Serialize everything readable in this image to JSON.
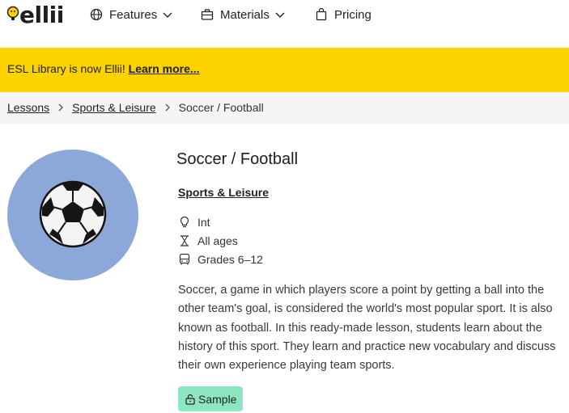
{
  "nav": {
    "logo": "ellii",
    "items": [
      {
        "label": "Features",
        "icon": "globe-icon"
      },
      {
        "label": "Materials",
        "icon": "briefcase-icon"
      },
      {
        "label": "Pricing",
        "icon": "shopping-bag-icon"
      }
    ]
  },
  "banner": {
    "text": "ESL Library is now Ellii! ",
    "link": "Learn more..."
  },
  "breadcrumb": {
    "items": [
      "Lessons",
      "Sports & Leisure",
      "Soccer / Football"
    ]
  },
  "lesson": {
    "title": "Soccer / Football",
    "category": "Sports & Leisure",
    "level": "Int",
    "ages": "All ages",
    "grades": "Grades 6–12",
    "description": "Soccer, a game in which players score a point by getting a ball into the other team's goal, is considered the world's most popular sport. It is also known as football. In this ready-made lesson, students learn about the history of this sport. They learn and practice new vocabulary and discuss their own experience playing team sports.",
    "sample_label": "Sample"
  },
  "colors": {
    "banner": "#fcd200",
    "circle": "#8ca8d8",
    "sample": "#8de6c2"
  }
}
